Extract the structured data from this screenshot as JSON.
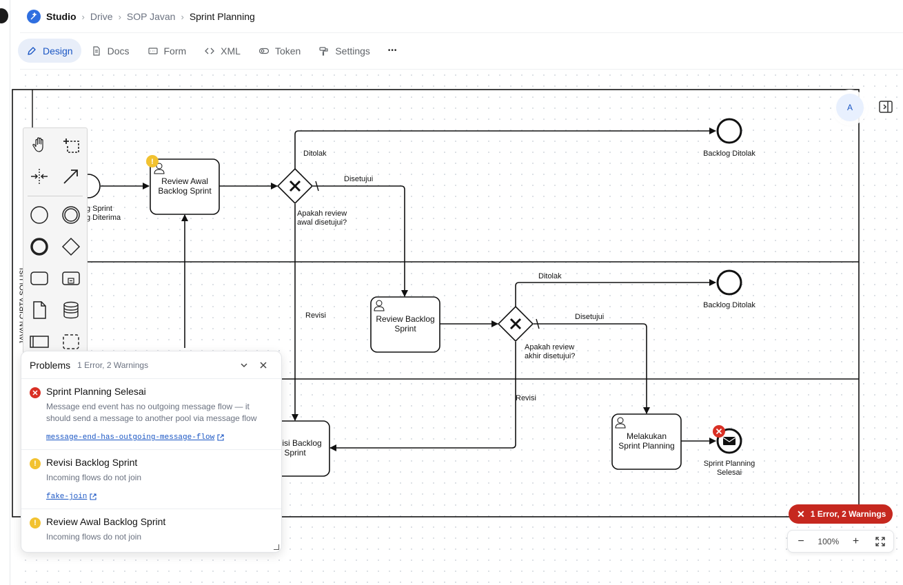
{
  "breadcrumb": {
    "app": "Studio",
    "items": [
      "Drive",
      "SOP Javan",
      "Sprint Planning"
    ]
  },
  "tabs": [
    {
      "label": "Design",
      "icon": "pen-icon",
      "active": true
    },
    {
      "label": "Docs",
      "icon": "document-icon"
    },
    {
      "label": "Form",
      "icon": "form-icon"
    },
    {
      "label": "XML",
      "icon": "code-icon"
    },
    {
      "label": "Token",
      "icon": "token-icon"
    },
    {
      "label": "Settings",
      "icon": "settings-icon"
    }
  ],
  "more_label": "•••",
  "diagram": {
    "lane_label": "JAVAN CIPTA SOLUSI",
    "start_event": "Backlog Sprint\nBacklog Diterima",
    "start_event_visible": [
      "g Sprint",
      "g Diterima"
    ],
    "task_review_awal": [
      "Review Awal",
      "Backlog Sprint"
    ],
    "gateway1_label": [
      "Apakah review",
      "awal disetujui?"
    ],
    "flow_ditolak_1": "Ditolak",
    "flow_disetujui_1": "Disetujui",
    "end_ditolak_1": "Backlog Ditolak",
    "flow_revisi_1": "Revisi",
    "task_review_backlog": [
      "Review Backlog",
      "Sprint"
    ],
    "gateway2_label": [
      "Apakah review",
      "akhir disetujui?"
    ],
    "flow_ditolak_2": "Ditolak",
    "flow_disetujui_2": "Disetujui",
    "end_ditolak_2": "Backlog Ditolak",
    "flow_revisi_2": "Revisi",
    "task_revisi": [
      "isi Backlog",
      "Sprint"
    ],
    "task_melakukan": [
      "Melakukan",
      "Sprint Planning"
    ],
    "end_message": [
      "Sprint Planning",
      "Selesai"
    ]
  },
  "palette": {
    "tools": [
      "hand-tool-icon",
      "lasso-tool-icon",
      "space-tool-icon",
      "connect-tool-icon",
      "start-event-icon",
      "intermediate-event-icon",
      "end-event-icon",
      "gateway-icon",
      "task-icon",
      "subprocess-icon",
      "data-object-icon",
      "data-store-icon",
      "pool-icon",
      "group-icon"
    ]
  },
  "problems": {
    "title": "Problems",
    "count": "1 Error, 2 Warnings",
    "items": [
      {
        "severity": "error",
        "title": "Sprint Planning Selesai",
        "message": "Message end event has no outgoing message flow — it should send a message to another pool via message flow",
        "link": "message-end-has-outgoing-message-flow"
      },
      {
        "severity": "warning",
        "title": "Revisi Backlog Sprint",
        "message": "Incoming flows do not join",
        "link": "fake-join"
      },
      {
        "severity": "warning",
        "title": "Review Awal Backlog Sprint",
        "message": "Incoming flows do not join",
        "link": "fake-join"
      }
    ]
  },
  "avatar_initial": "A",
  "issues_badge": "1 Error, 2 Warnings",
  "zoom": {
    "level": "100%",
    "minus": "−",
    "plus": "+"
  },
  "colors": {
    "accent": "#1a56c4",
    "error": "#d93025",
    "warning": "#f2c230",
    "badge_bg": "#c6281f"
  }
}
